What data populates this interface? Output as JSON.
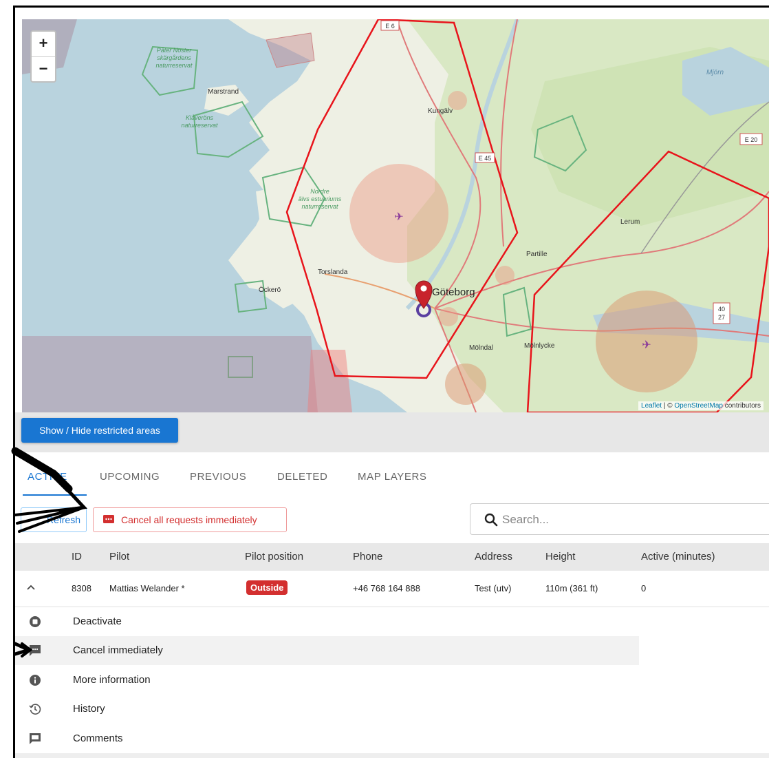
{
  "map": {
    "zoom_in": "+",
    "zoom_out": "−",
    "labels": {
      "e6": "E 6",
      "e45": "E 45",
      "e20": "E 20",
      "r40": "40",
      "r27": "27",
      "pater_noster_1": "Påter Noster",
      "pater_noster_2": "skärgårdens",
      "pater_noster_3": "naturreservat",
      "marstrand": "Marstrand",
      "klaveron_1": "Klåveröns",
      "klaveron_2": "naturreservat",
      "kungalv": "Kungälv",
      "nordre_1": "Nordre",
      "nordre_2": "älvs estuariums",
      "nordre_3": "naturreservat",
      "torslanda": "Torslanda",
      "ockero": "Öckerö",
      "goteborg": "Göteborg",
      "partille": "Partille",
      "lerum": "Lerum",
      "molndal": "Mölndal",
      "molnlycke": "Mölnlycke",
      "mjorn": "Mjörn"
    },
    "attribution": {
      "leaflet": "Leaflet",
      "sep": " | © ",
      "osm": "OpenStreetMap",
      "contrib": " contributors"
    }
  },
  "show_hide_button": "Show / Hide restricted areas",
  "tabs": [
    {
      "label": "ACTIVE",
      "active": true
    },
    {
      "label": "UPCOMING",
      "active": false
    },
    {
      "label": "PREVIOUS",
      "active": false
    },
    {
      "label": "DELETED",
      "active": false
    },
    {
      "label": "MAP LAYERS",
      "active": false
    }
  ],
  "toolbar": {
    "refresh_label": "Refresh",
    "cancel_all_label": "Cancel all requests immediately"
  },
  "search": {
    "placeholder": "Search..."
  },
  "table": {
    "headers": [
      "ID",
      "Pilot",
      "Pilot position",
      "Phone",
      "Address",
      "Height",
      "Active (minutes)"
    ],
    "row": {
      "id": "8308",
      "pilot": "Mattias Welander *",
      "position": "Outside",
      "phone": "+46 768 164 888",
      "address": "Test (utv)",
      "height": "110m (361 ft)",
      "active_minutes": "0"
    }
  },
  "actions": [
    {
      "label": "Deactivate",
      "icon": "stop-circle-icon"
    },
    {
      "label": "Cancel immediately",
      "icon": "message-icon"
    },
    {
      "label": "More information",
      "icon": "info-icon"
    },
    {
      "label": "History",
      "icon": "history-icon"
    },
    {
      "label": "Comments",
      "icon": "comment-icon"
    }
  ],
  "colors": {
    "primary": "#1976d2",
    "danger": "#d32f2f",
    "zone_border": "#e8141b"
  }
}
